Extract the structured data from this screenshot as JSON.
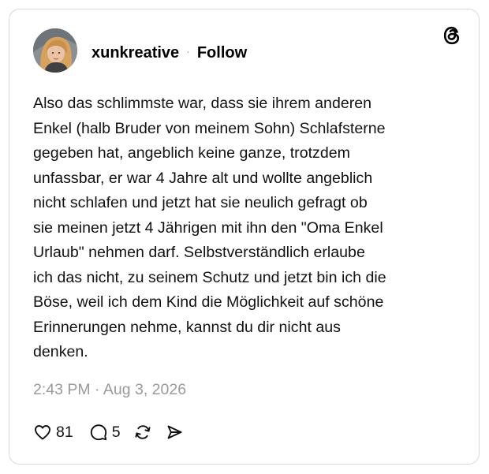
{
  "post": {
    "author": {
      "username": "xunkreative",
      "separator": "·",
      "follow_label": "Follow",
      "avatar_icon": "user-avatar-photo"
    },
    "brand_icon": "threads-logo-icon",
    "text_lines": [
      "Also das schlimmste war, dass sie ihrem anderen",
      "Enkel (halb Bruder von meinem Sohn) Schlafsterne",
      "gegeben hat, angeblich keine ganze, trotzdem",
      "unfassbar, er war 4 Jahre alt und wollte angeblich",
      "nicht schlafen und jetzt hat sie neulich gefragt ob",
      "sie meinen jetzt 4 Jährigen mit ihn den \"Oma Enkel",
      "Urlaub\" nehmen darf. Selbstverständlich erlaube",
      "ich das nicht, zu seinem Schutz und jetzt bin ich die",
      "Böse, weil ich dem Kind die Möglichkeit auf schöne",
      "Erinnerungen nehme, kannst du dir nicht aus",
      "denken."
    ],
    "timestamp": "2:43 PM · Aug 3, 2026",
    "actions": {
      "likes": "81",
      "replies": "5",
      "like_icon": "heart-icon",
      "reply_icon": "comment-icon",
      "repost_icon": "repost-icon",
      "share_icon": "send-icon"
    }
  },
  "colors": {
    "border": "#d9d9d9",
    "text": "#111111",
    "muted": "#9a9a9a"
  }
}
